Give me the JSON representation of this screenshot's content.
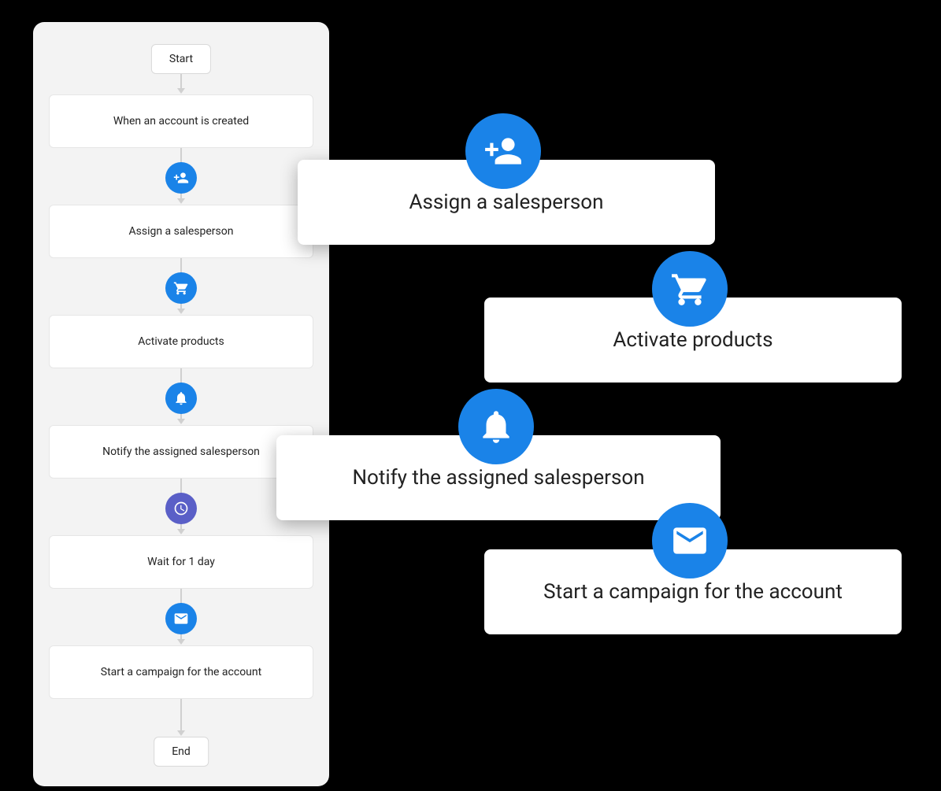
{
  "flow": {
    "start": "Start",
    "end": "End",
    "steps": {
      "trigger": "When an account is created",
      "assign": "Assign a salesperson",
      "activate": "Activate products",
      "notify": "Notify the assigned salesperson",
      "wait": "Wait for 1 day",
      "campaign": "Start a campaign for the account"
    }
  },
  "highlights": {
    "assign": "Assign a salesperson",
    "activate": "Activate products",
    "notify": "Notify the assigned salesperson",
    "campaign": "Start a campaign for the account"
  },
  "colors": {
    "blue": "#1a83e8",
    "purple": "#5a5fc7",
    "panel": "#f3f3f3"
  }
}
